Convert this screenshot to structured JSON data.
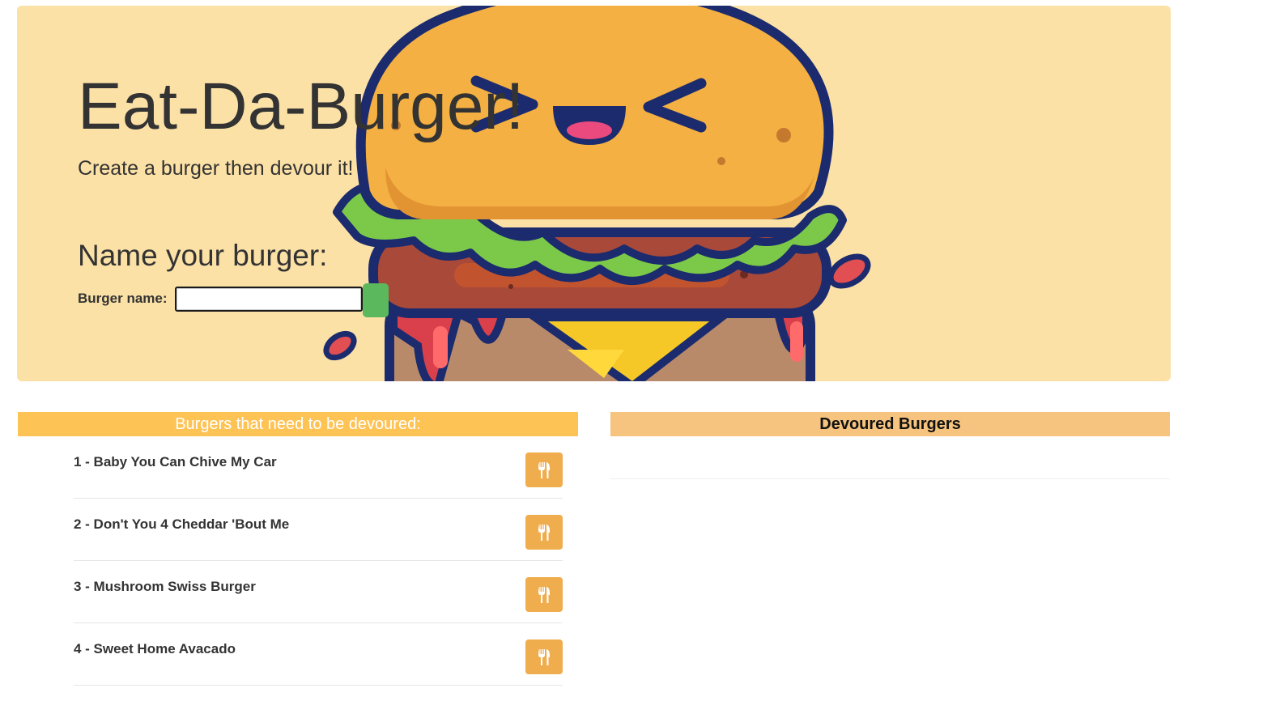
{
  "jumbotron": {
    "title": "Eat-Da-Burger!",
    "subtitle": "Create a burger then devour it!"
  },
  "create_form": {
    "heading": "Name your burger:",
    "label": "Burger name:",
    "input_value": "",
    "submit_color": "#5cb85c"
  },
  "undevoured_panel": {
    "header": "Burgers that need to be devoured:",
    "header_color": "#fec355",
    "items": [
      {
        "label": "1 - Baby You Can Chive My Car",
        "button_icon": "utensils-icon"
      },
      {
        "label": "2 - Don't You 4 Cheddar 'Bout Me",
        "button_icon": "utensils-icon"
      },
      {
        "label": "3 - Mushroom Swiss Burger",
        "button_icon": "utensils-icon"
      },
      {
        "label": "4 - Sweet Home Avacado",
        "button_icon": "utensils-icon"
      }
    ],
    "button_color": "#f0ad4e"
  },
  "devoured_panel": {
    "header": "Devoured Burgers",
    "header_color": "#f6c47f",
    "items": []
  },
  "background": {
    "hero_color": "#fbe1a6",
    "illustration": "kawaii-burger-illustration"
  }
}
